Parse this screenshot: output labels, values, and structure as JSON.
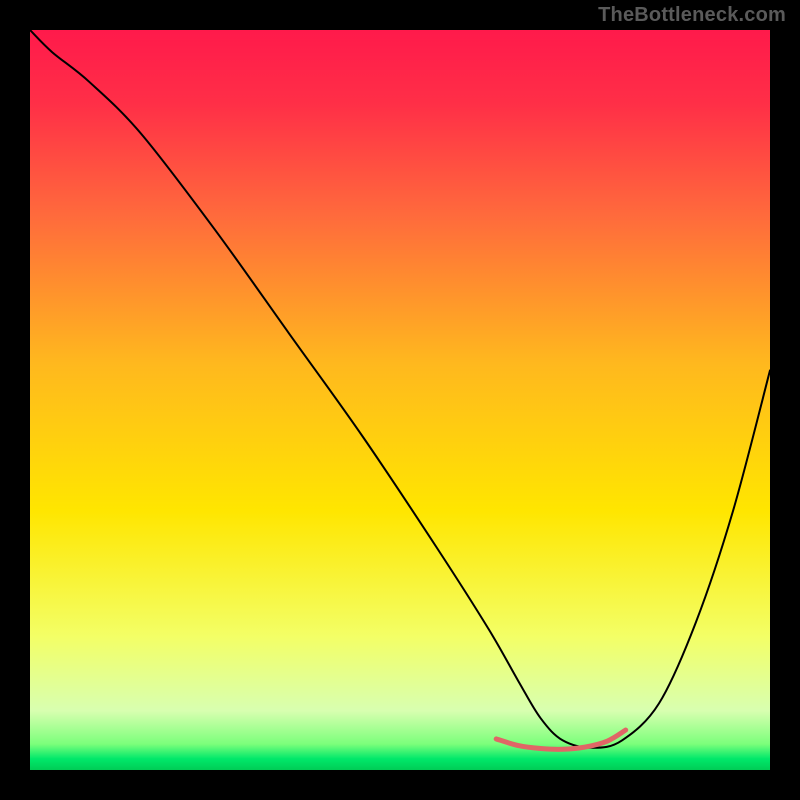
{
  "watermark": "TheBottleneck.com",
  "chart_data": {
    "type": "line",
    "title": "",
    "xlabel": "",
    "ylabel": "",
    "xlim": [
      0,
      100
    ],
    "ylim": [
      0,
      100
    ],
    "grid": false,
    "legend": false,
    "gradient_stops": [
      {
        "offset": 0.0,
        "color": "#ff1a4b"
      },
      {
        "offset": 0.1,
        "color": "#ff2f47"
      },
      {
        "offset": 0.25,
        "color": "#ff6a3c"
      },
      {
        "offset": 0.45,
        "color": "#ffb81e"
      },
      {
        "offset": 0.65,
        "color": "#ffe600"
      },
      {
        "offset": 0.82,
        "color": "#f3ff66"
      },
      {
        "offset": 0.92,
        "color": "#d8ffb0"
      },
      {
        "offset": 0.965,
        "color": "#7bff7b"
      },
      {
        "offset": 0.985,
        "color": "#00e86a"
      },
      {
        "offset": 1.0,
        "color": "#00cc55"
      }
    ],
    "series": [
      {
        "name": "bottleneck-curve",
        "color": "#000000",
        "x": [
          0,
          3,
          8,
          15,
          25,
          35,
          45,
          55,
          62,
          66,
          69,
          72,
          76,
          80,
          85,
          90,
          95,
          100
        ],
        "y": [
          100,
          97,
          93,
          86,
          73,
          59,
          45,
          30,
          19,
          12,
          7,
          4,
          3,
          4,
          9,
          20,
          35,
          54
        ]
      }
    ],
    "annotations": [
      {
        "name": "highlight-trough",
        "color": "#e06666",
        "width": 5,
        "x": [
          63,
          66,
          69,
          72,
          75,
          78,
          80.5
        ],
        "y": [
          4.2,
          3.3,
          2.9,
          2.8,
          3.1,
          3.9,
          5.4
        ]
      }
    ]
  }
}
